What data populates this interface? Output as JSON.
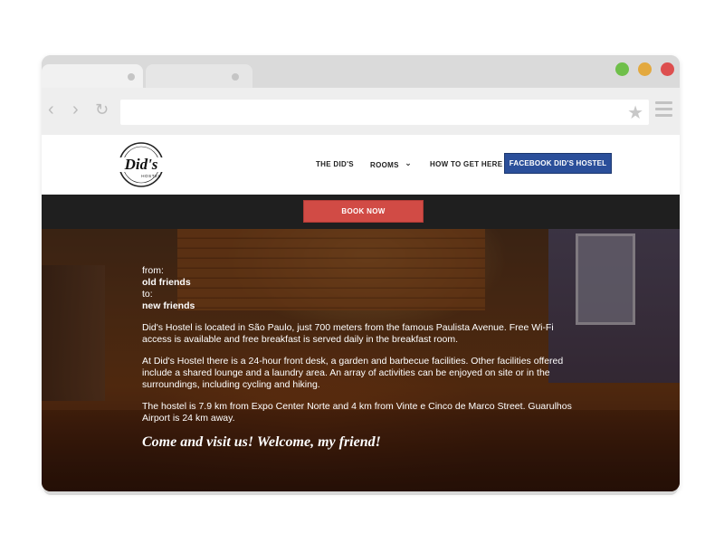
{
  "browser": {
    "buttons": {
      "back_icon": "‹",
      "forward_icon": "›",
      "reload_icon": "↻"
    },
    "window_colors": {
      "green": "#6fbf4a",
      "yellow": "#e3a93f",
      "red": "#dd4f4f"
    }
  },
  "nav": {
    "logo_text": "Did's",
    "logo_subtext": "HOSTEL",
    "items": [
      {
        "label": "THE DID'S"
      },
      {
        "label": "ROOMS"
      },
      {
        "label": "HOW TO GET HERE"
      }
    ],
    "rooms_caret": "⌄",
    "facebook_label": "FACEBOOK DID'S HOSTEL"
  },
  "book": {
    "label": "BOOK NOW"
  },
  "hero": {
    "from_label": "from:",
    "from_value": "old friends",
    "to_label": "to:",
    "to_value": "new friends",
    "paragraphs": [
      "Did's Hostel is located in São Paulo, just 700 meters from the famous Paulista Avenue. Free Wi-Fi access is available and free breakfast is served daily in the breakfast room.",
      "At Did's Hostel there is a 24-hour front desk, a garden and barbecue facilities. Other facilities offered include a shared lounge and a laundry area. An array of activities can be enjoyed on site or in the surroundings, including cycling and hiking.",
      "The hostel is 7.9 km from Expo Center Norte and 4 km from Vinte e Cinco de Marco Street. Guarulhos Airport is 24 km away."
    ],
    "closing": "Come and visit us! Welcome, my friend!"
  }
}
